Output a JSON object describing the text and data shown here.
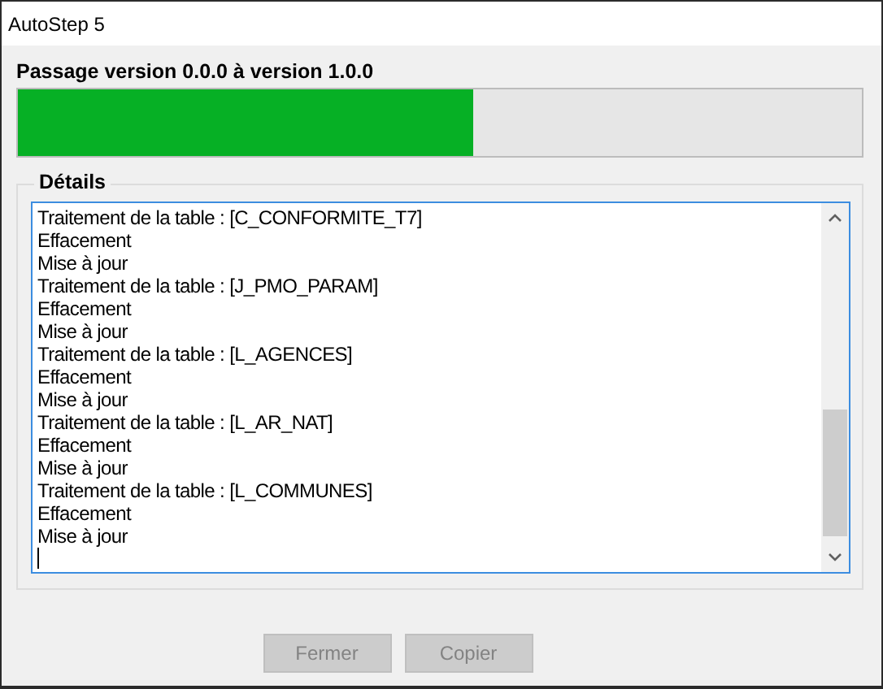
{
  "window": {
    "title": "AutoStep 5"
  },
  "progress": {
    "label": "Passage version 0.0.0 à version 1.0.0",
    "level": 0.54
  },
  "details": {
    "legend": "Détails",
    "lines": [
      "Traitement de la table : [C_CONFORMITE_T7]",
      "Effacement",
      "Mise à jour",
      "Traitement de la table : [J_PMO_PARAM]",
      "Effacement",
      "Mise à jour",
      "Traitement de la table : [L_AGENCES]",
      "Effacement",
      "Mise à jour",
      "Traitement de la table : [L_AR_NAT]",
      "Effacement",
      "Mise à jour",
      "Traitement de la table : [L_COMMUNES]",
      "Effacement",
      "Mise à jour"
    ]
  },
  "buttons": [
    {
      "label": "Fermer",
      "disabled": true
    },
    {
      "label": "Copier",
      "disabled": true
    }
  ]
}
